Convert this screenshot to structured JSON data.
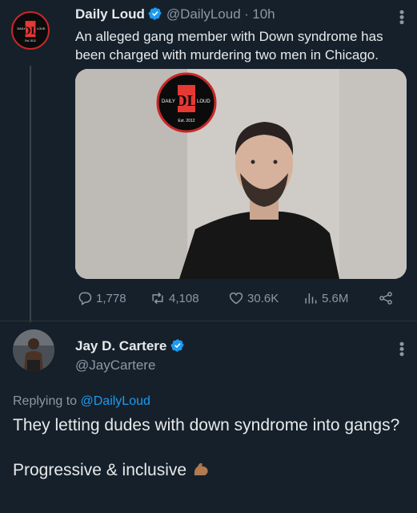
{
  "tweet": {
    "author_name": "Daily Loud",
    "author_handle": "@DailyLoud",
    "separator": "·",
    "time": "10h",
    "text": "An alleged gang member with Down syndrome has been charged with murdering two men in Chicago.",
    "logo": {
      "left": "DAILY",
      "right": "LOUD",
      "bottom": "Est. 2012",
      "monogram": "DL"
    },
    "stats": {
      "replies": "1,778",
      "reposts": "4,108",
      "likes": "30.6K",
      "views": "5.6M"
    }
  },
  "reply": {
    "author_name": "Jay D. Cartere",
    "author_handle": "@JayCartere",
    "replying_prefix": "Replying to",
    "replying_mention": "@DailyLoud",
    "text_line1": "They letting dudes with down syndrome into gangs?",
    "text_line2": "Progressive & inclusive",
    "emoji": "flexed-biceps"
  },
  "colors": {
    "background": "#15202b",
    "text": "#e7e9ea",
    "muted": "#8b98a5",
    "accent": "#1d9bf0",
    "logo_red": "#c62828"
  }
}
